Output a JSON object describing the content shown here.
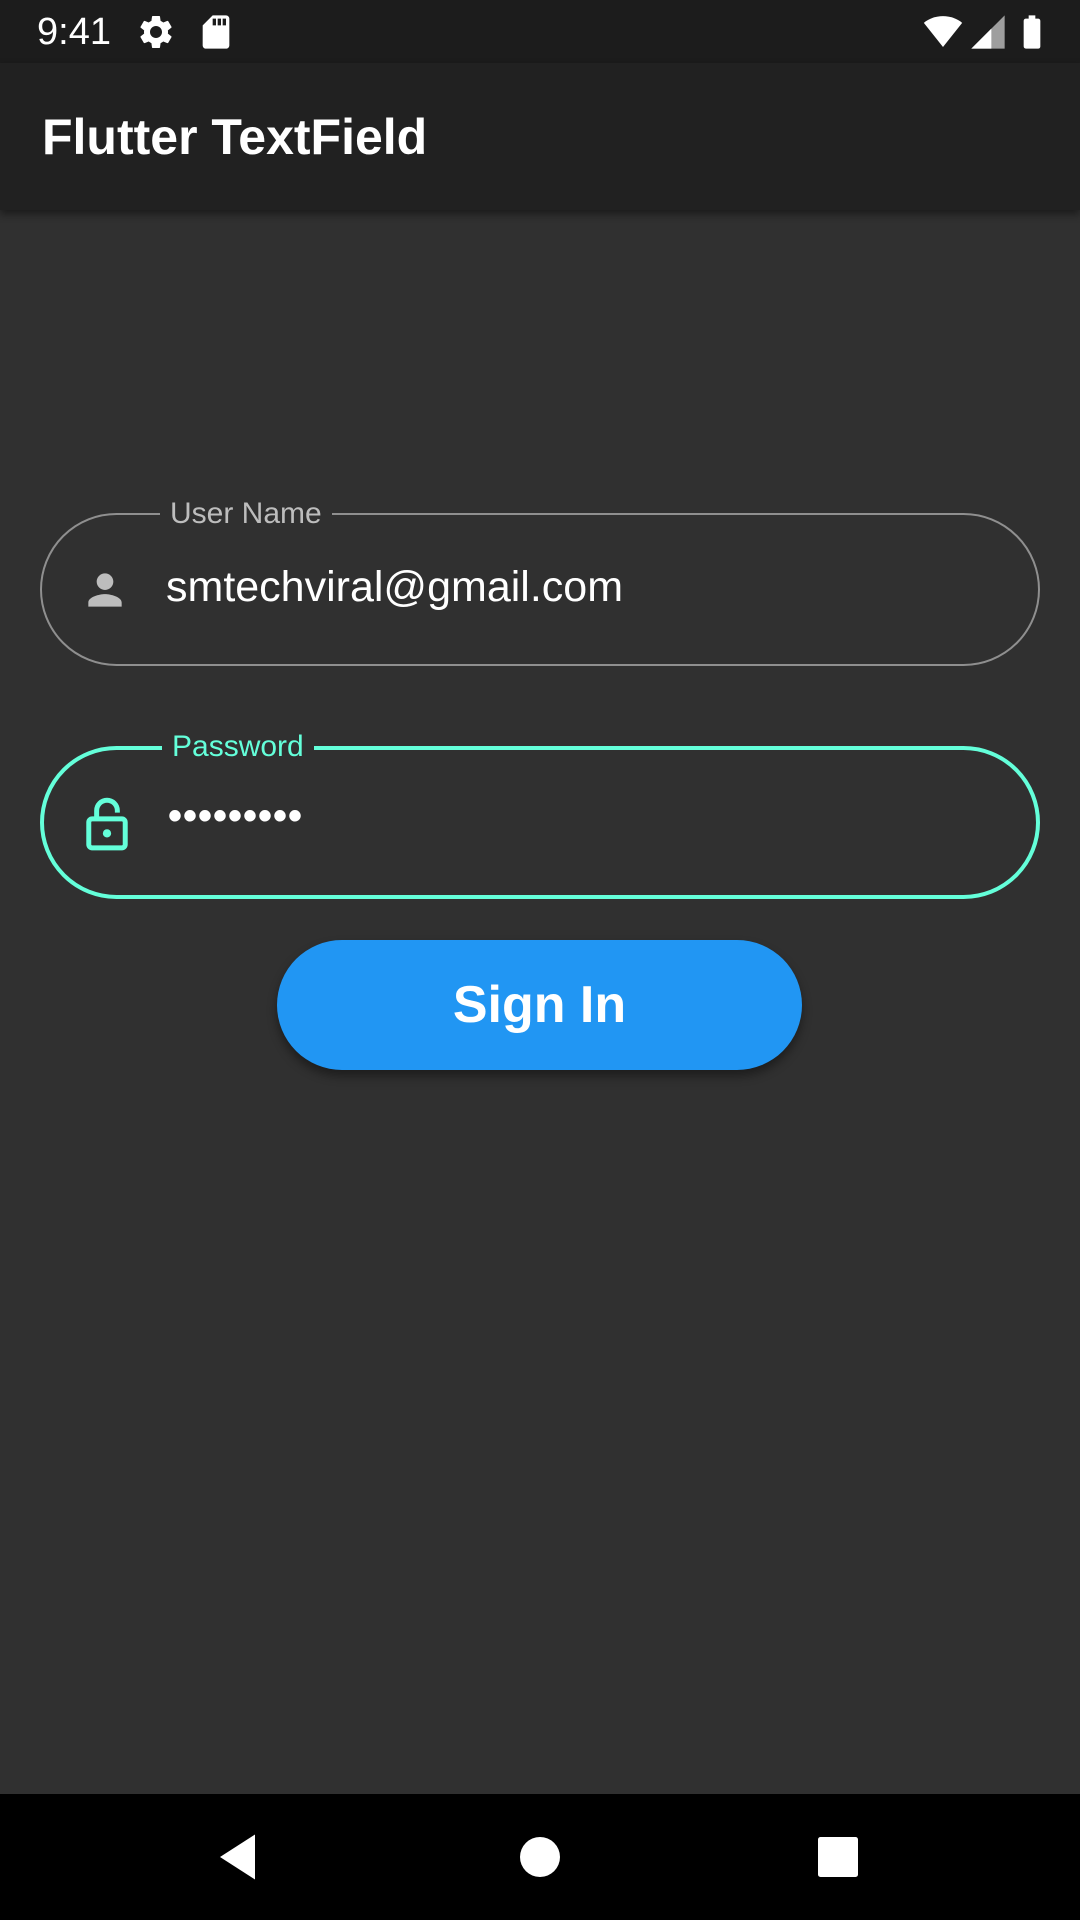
{
  "status_bar": {
    "time": "9:41",
    "icons": [
      "gear-icon",
      "sd-card-icon",
      "wifi-icon",
      "signal-icon",
      "battery-icon"
    ]
  },
  "app_bar": {
    "title": "Flutter TextField"
  },
  "form": {
    "username": {
      "label": "User Name",
      "value": "smtechviral@gmail.com",
      "icon": "person-icon"
    },
    "password": {
      "label": "Password",
      "value": "•••••••••",
      "icon": "lock-icon",
      "focused": true
    },
    "sign_in_label": "Sign In"
  },
  "nav_bar": {
    "buttons": [
      "back-icon",
      "home-icon",
      "recents-icon"
    ]
  },
  "colors": {
    "background": "#303030",
    "app_bar": "#212121",
    "accent": "#64ffda",
    "button": "#2196f3",
    "unfocused_border": "#8f8f8f"
  }
}
